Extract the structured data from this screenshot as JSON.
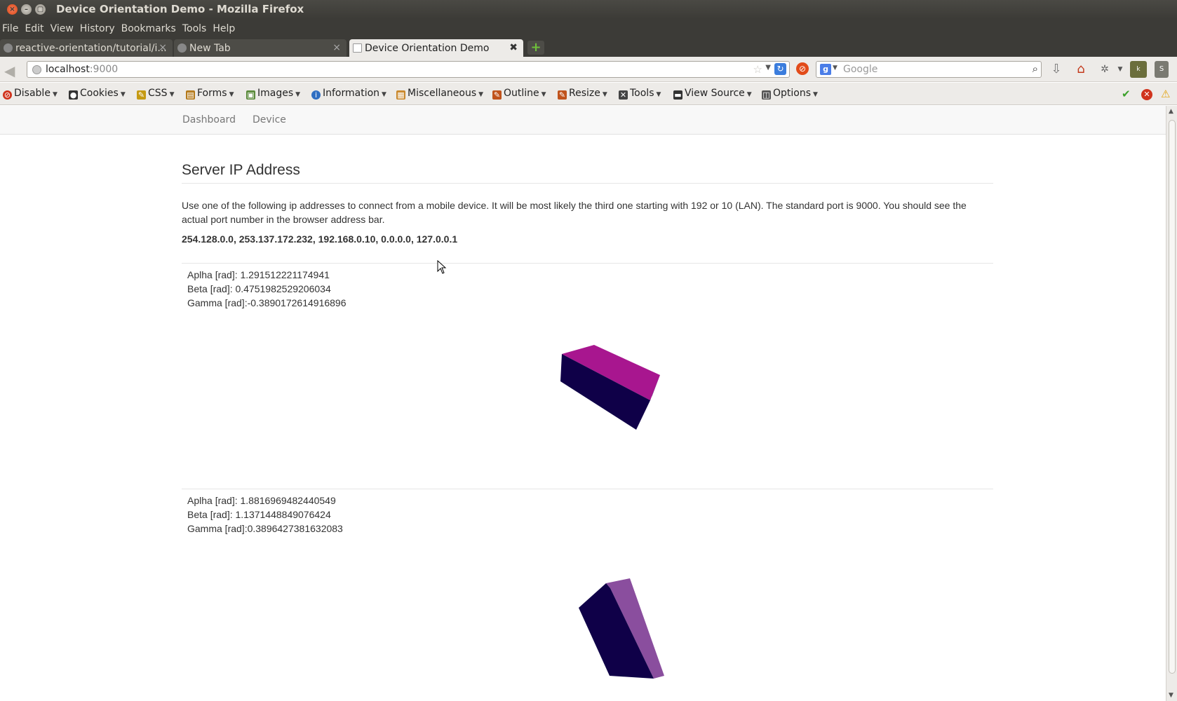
{
  "window": {
    "title": "Device Orientation Demo - Mozilla Firefox"
  },
  "menu": [
    "File",
    "Edit",
    "View",
    "History",
    "Bookmarks",
    "Tools",
    "Help"
  ],
  "tabs": [
    {
      "label": "reactive-orientation/tutorial/i...",
      "active": false
    },
    {
      "label": "New Tab",
      "active": false
    },
    {
      "label": "Device Orientation Demo",
      "active": true
    }
  ],
  "url": {
    "host": "localhost",
    "port": ":9000"
  },
  "search": {
    "placeholder": "Google"
  },
  "devtoolbar": [
    {
      "label": "Disable",
      "icon": "disable-icon",
      "color": "#d0331c"
    },
    {
      "label": "Cookies",
      "icon": "cookies-icon",
      "color": "#333333"
    },
    {
      "label": "CSS",
      "icon": "css-icon",
      "color": "#c59a12"
    },
    {
      "label": "Forms",
      "icon": "forms-icon",
      "color": "#b4791a"
    },
    {
      "label": "Images",
      "icon": "images-icon",
      "color": "#5a8a3a"
    },
    {
      "label": "Information",
      "icon": "information-icon",
      "color": "#2f6fc2"
    },
    {
      "label": "Miscellaneous",
      "icon": "miscellaneous-icon",
      "color": "#c9872a"
    },
    {
      "label": "Outline",
      "icon": "outline-icon",
      "color": "#c0531c"
    },
    {
      "label": "Resize",
      "icon": "resize-icon",
      "color": "#c0531c"
    },
    {
      "label": "Tools",
      "icon": "tools-icon",
      "color": "#444444"
    },
    {
      "label": "View Source",
      "icon": "view-source-icon",
      "color": "#333333"
    },
    {
      "label": "Options",
      "icon": "options-icon",
      "color": "#555555"
    }
  ],
  "site_nav": [
    "Dashboard",
    "Device"
  ],
  "section": {
    "title": "Server IP Address",
    "description": "Use one of the following ip addresses to connect from a mobile device. It will be most likely the third one starting with 192 or 10 (LAN). The standard port is 9000. You should see the actual port number in the browser address bar.",
    "ips": "254.128.0.0, 253.137.172.232, 192.168.0.10, 0.0.0.0, 127.0.0.1"
  },
  "readouts": [
    {
      "alpha": "Aplha [rad]: 1.291512221174941",
      "beta": "Beta [rad]: 0.4751982529206034",
      "gamma": "Gamma [rad]:-0.3890172614916896"
    },
    {
      "alpha": "Aplha [rad]: 1.8816969482440549",
      "beta": "Beta [rad]: 1.1371448849076424",
      "gamma": "Gamma [rad]:0.3896427381632083"
    }
  ],
  "colors": {
    "cube_dark": "#0f0048",
    "cube1_top": "#a8168f",
    "cube2_side": "#8a4e9e"
  }
}
